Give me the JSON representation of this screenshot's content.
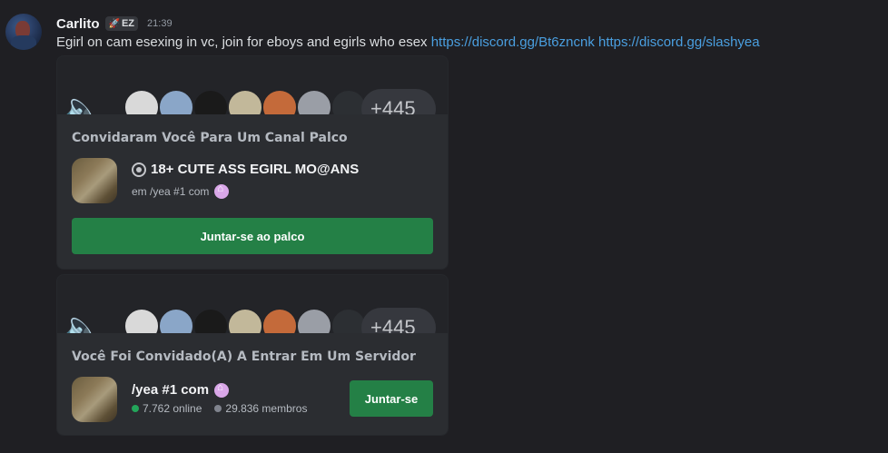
{
  "message": {
    "username": "Carlito",
    "tag_label": "EZ",
    "timestamp": "21:39",
    "text": "Egirl on cam esexing in vc, join for eboys and egirls who esex",
    "links": [
      "https://discord.gg/Bt6zncnk",
      "https://discord.gg/slashyea"
    ]
  },
  "stage_invite": {
    "title": "Convidaram Você Para Um Canal Palco",
    "stage_name": "18+ CUTE ASS EGIRL MO@ANS",
    "server_line": "em /yea #1 com",
    "member_overflow": "+445",
    "button_label": "Juntar-se ao palco"
  },
  "server_invite": {
    "title": "Você Foi Convidado(A) A Entrar Em Um Servidor",
    "server_name": "/yea #1 com",
    "online": "7.762 online",
    "members": "29.836 membros",
    "member_overflow": "+445",
    "button_label": "Juntar-se"
  },
  "colors": {
    "background": "#1f1f23",
    "card": "#2b2d31",
    "link": "#4a9fe0",
    "join_green": "#248046",
    "online_green": "#23a55a"
  },
  "icons": [
    "speaker-icon",
    "stage-icon",
    "server-badge-icon",
    "rocket-icon"
  ]
}
